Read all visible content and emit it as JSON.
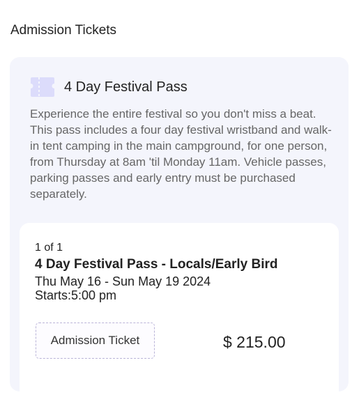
{
  "section": {
    "title": "Admission Tickets"
  },
  "pass": {
    "icon": "ticket-icon",
    "title": "4 Day Festival Pass",
    "description": "Experience the entire festival so you don't miss a beat. This pass includes a four day festival wristband and walk-in tent camping in the main campground, for one person, from Thursday at 8am 'til Monday 11am. Vehicle passes, parking passes and early entry must be purchased separately."
  },
  "ticket": {
    "count": "1 of 1",
    "name": "4 Day Festival Pass - Locals/Early Bird",
    "dates": "Thu May 16 - Sun May 19 2024",
    "start": "Starts:5:00 pm",
    "type_label": "Admission Ticket",
    "price": "$ 215.00"
  },
  "colors": {
    "panel_bg": "#f4f5fc",
    "icon_color": "#dcdcfb",
    "button_border": "#b9b3d8"
  }
}
